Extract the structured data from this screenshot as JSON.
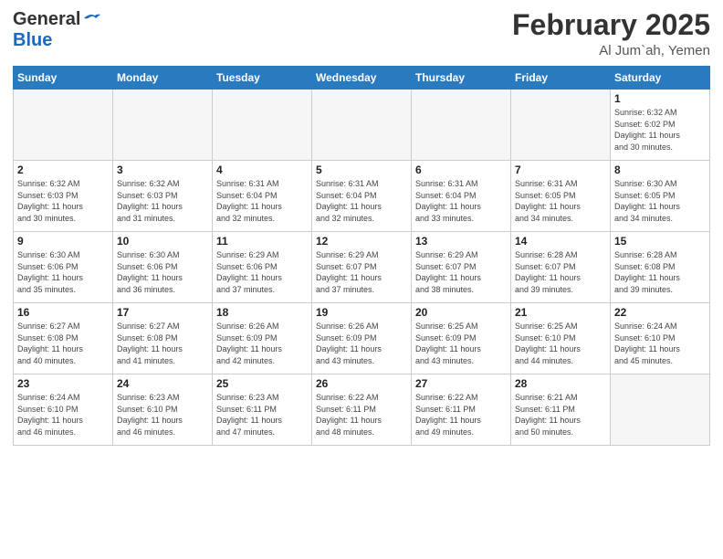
{
  "header": {
    "logo_general": "General",
    "logo_blue": "Blue",
    "title": "February 2025",
    "location": "Al Jum`ah, Yemen"
  },
  "calendar": {
    "weekdays": [
      "Sunday",
      "Monday",
      "Tuesday",
      "Wednesday",
      "Thursday",
      "Friday",
      "Saturday"
    ],
    "weeks": [
      [
        {
          "day": "",
          "info": ""
        },
        {
          "day": "",
          "info": ""
        },
        {
          "day": "",
          "info": ""
        },
        {
          "day": "",
          "info": ""
        },
        {
          "day": "",
          "info": ""
        },
        {
          "day": "",
          "info": ""
        },
        {
          "day": "1",
          "info": "Sunrise: 6:32 AM\nSunset: 6:02 PM\nDaylight: 11 hours\nand 30 minutes."
        }
      ],
      [
        {
          "day": "2",
          "info": "Sunrise: 6:32 AM\nSunset: 6:03 PM\nDaylight: 11 hours\nand 30 minutes."
        },
        {
          "day": "3",
          "info": "Sunrise: 6:32 AM\nSunset: 6:03 PM\nDaylight: 11 hours\nand 31 minutes."
        },
        {
          "day": "4",
          "info": "Sunrise: 6:31 AM\nSunset: 6:04 PM\nDaylight: 11 hours\nand 32 minutes."
        },
        {
          "day": "5",
          "info": "Sunrise: 6:31 AM\nSunset: 6:04 PM\nDaylight: 11 hours\nand 32 minutes."
        },
        {
          "day": "6",
          "info": "Sunrise: 6:31 AM\nSunset: 6:04 PM\nDaylight: 11 hours\nand 33 minutes."
        },
        {
          "day": "7",
          "info": "Sunrise: 6:31 AM\nSunset: 6:05 PM\nDaylight: 11 hours\nand 34 minutes."
        },
        {
          "day": "8",
          "info": "Sunrise: 6:30 AM\nSunset: 6:05 PM\nDaylight: 11 hours\nand 34 minutes."
        }
      ],
      [
        {
          "day": "9",
          "info": "Sunrise: 6:30 AM\nSunset: 6:06 PM\nDaylight: 11 hours\nand 35 minutes."
        },
        {
          "day": "10",
          "info": "Sunrise: 6:30 AM\nSunset: 6:06 PM\nDaylight: 11 hours\nand 36 minutes."
        },
        {
          "day": "11",
          "info": "Sunrise: 6:29 AM\nSunset: 6:06 PM\nDaylight: 11 hours\nand 37 minutes."
        },
        {
          "day": "12",
          "info": "Sunrise: 6:29 AM\nSunset: 6:07 PM\nDaylight: 11 hours\nand 37 minutes."
        },
        {
          "day": "13",
          "info": "Sunrise: 6:29 AM\nSunset: 6:07 PM\nDaylight: 11 hours\nand 38 minutes."
        },
        {
          "day": "14",
          "info": "Sunrise: 6:28 AM\nSunset: 6:07 PM\nDaylight: 11 hours\nand 39 minutes."
        },
        {
          "day": "15",
          "info": "Sunrise: 6:28 AM\nSunset: 6:08 PM\nDaylight: 11 hours\nand 39 minutes."
        }
      ],
      [
        {
          "day": "16",
          "info": "Sunrise: 6:27 AM\nSunset: 6:08 PM\nDaylight: 11 hours\nand 40 minutes."
        },
        {
          "day": "17",
          "info": "Sunrise: 6:27 AM\nSunset: 6:08 PM\nDaylight: 11 hours\nand 41 minutes."
        },
        {
          "day": "18",
          "info": "Sunrise: 6:26 AM\nSunset: 6:09 PM\nDaylight: 11 hours\nand 42 minutes."
        },
        {
          "day": "19",
          "info": "Sunrise: 6:26 AM\nSunset: 6:09 PM\nDaylight: 11 hours\nand 43 minutes."
        },
        {
          "day": "20",
          "info": "Sunrise: 6:25 AM\nSunset: 6:09 PM\nDaylight: 11 hours\nand 43 minutes."
        },
        {
          "day": "21",
          "info": "Sunrise: 6:25 AM\nSunset: 6:10 PM\nDaylight: 11 hours\nand 44 minutes."
        },
        {
          "day": "22",
          "info": "Sunrise: 6:24 AM\nSunset: 6:10 PM\nDaylight: 11 hours\nand 45 minutes."
        }
      ],
      [
        {
          "day": "23",
          "info": "Sunrise: 6:24 AM\nSunset: 6:10 PM\nDaylight: 11 hours\nand 46 minutes."
        },
        {
          "day": "24",
          "info": "Sunrise: 6:23 AM\nSunset: 6:10 PM\nDaylight: 11 hours\nand 46 minutes."
        },
        {
          "day": "25",
          "info": "Sunrise: 6:23 AM\nSunset: 6:11 PM\nDaylight: 11 hours\nand 47 minutes."
        },
        {
          "day": "26",
          "info": "Sunrise: 6:22 AM\nSunset: 6:11 PM\nDaylight: 11 hours\nand 48 minutes."
        },
        {
          "day": "27",
          "info": "Sunrise: 6:22 AM\nSunset: 6:11 PM\nDaylight: 11 hours\nand 49 minutes."
        },
        {
          "day": "28",
          "info": "Sunrise: 6:21 AM\nSunset: 6:11 PM\nDaylight: 11 hours\nand 50 minutes."
        },
        {
          "day": "",
          "info": ""
        }
      ]
    ]
  }
}
